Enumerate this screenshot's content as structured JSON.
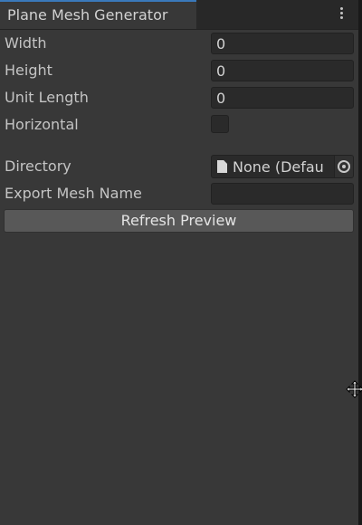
{
  "window": {
    "tab_title": "Plane Mesh Generator",
    "menu_icon": "kebab-menu-icon"
  },
  "properties": {
    "width": {
      "label": "Width",
      "value": "0"
    },
    "height": {
      "label": "Height",
      "value": "0"
    },
    "unit_length": {
      "label": "Unit Length",
      "value": "0"
    },
    "horizontal": {
      "label": "Horizontal",
      "checked": false
    },
    "directory": {
      "label": "Directory",
      "value": "None (Defau",
      "icon": "file-icon",
      "picker_icon": "object-picker-icon"
    },
    "export_mesh_name": {
      "label": "Export Mesh Name",
      "value": ""
    }
  },
  "actions": {
    "refresh_preview_label": "Refresh Preview"
  },
  "colors": {
    "panel_bg": "#383838",
    "field_bg": "#2a2a2a",
    "button_bg": "#585858",
    "tab_accent": "#3a79bb"
  }
}
